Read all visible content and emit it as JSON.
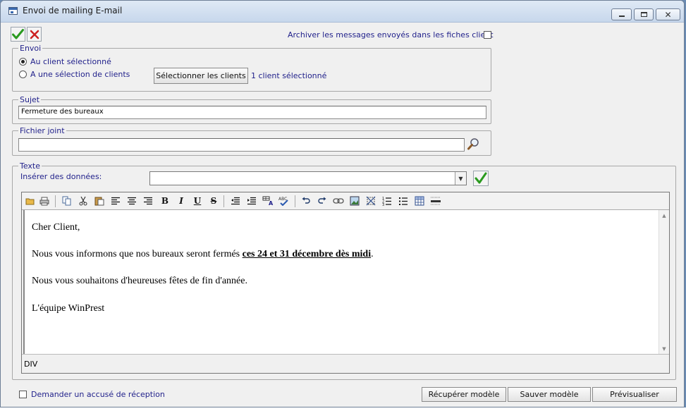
{
  "window": {
    "title": "Envoi de mailing E-mail",
    "controls": [
      "minimize",
      "maximize",
      "close"
    ]
  },
  "toolbar": {
    "validate_icon": "check-green-icon",
    "cancel_icon": "x-red-icon",
    "archive_label": "Archiver les messages envoyés dans les fiches client",
    "archive_checked": false
  },
  "envoi": {
    "legend": "Envoi",
    "option_selected_client": "Au client sélectionné",
    "option_selection": "A une sélection de clients",
    "selected_option": "Au client sélectionné",
    "select_clients_button": "Sélectionner les clients",
    "selected_count": "1 client sélectionné"
  },
  "sujet": {
    "legend": "Sujet",
    "value": "Fermeture des bureaux"
  },
  "fichier": {
    "legend": "Fichier joint",
    "value": "",
    "browse_icon": "magnifier-icon"
  },
  "texte": {
    "legend": "Texte",
    "insert_label": "Insérer des données:",
    "insert_value": "",
    "toolbar_icons": [
      "open-icon",
      "print-icon",
      "copy-icon",
      "cut-icon",
      "paste-icon",
      "align-left-icon",
      "align-center-icon",
      "align-right-icon",
      "bold-icon",
      "italic-icon",
      "underline-icon",
      "strikethrough-icon",
      "outdent-icon",
      "indent-icon",
      "font-color-icon",
      "spellcheck-icon",
      "undo-icon",
      "redo-icon",
      "link-icon",
      "image-icon",
      "remove-format-icon",
      "ordered-list-icon",
      "unordered-list-icon",
      "table-icon",
      "horizontal-rule-icon"
    ],
    "body": {
      "line1": "Cher Client,",
      "line2_before": "Nous vous informons que nos bureaux seront fermés ",
      "line2_bold": "ces 24 et 31 décembre dès midi",
      "line2_after": ".",
      "line3": "Nous vous souhaitons d'heureuses fêtes de fin d'année.",
      "line4": "L'équipe WinPrest"
    },
    "status_path": "DIV"
  },
  "footer": {
    "ack_label": "Demander un accusé de réception",
    "ack_checked": false,
    "recover_button": "Récupérer modèle",
    "save_model_button": "Sauver modèle",
    "preview_button": "Prévisualiser"
  },
  "colors": {
    "label_blue": "#1f1f8a",
    "validate_green": "#2a9a1f",
    "cancel_red": "#cc1f1f"
  }
}
